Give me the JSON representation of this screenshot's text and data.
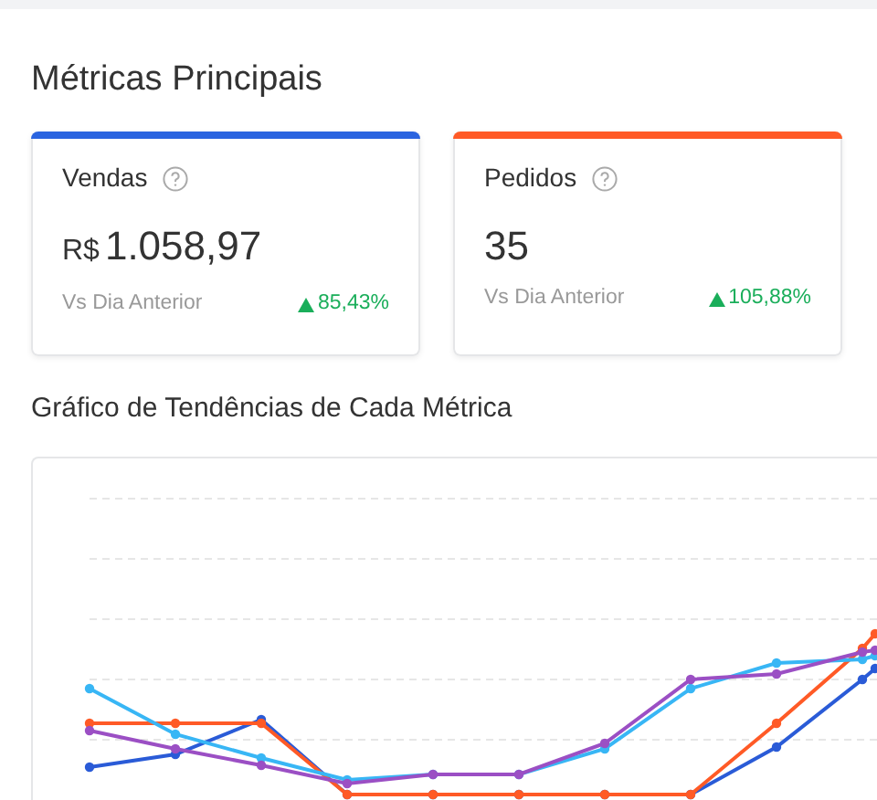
{
  "section_title": "Métricas Principais",
  "metrics": [
    {
      "label": "Vendas",
      "currency": "R$",
      "value": "1.058,97",
      "comparison_label": "Vs Dia Anterior",
      "change": "85,43%",
      "positive": true,
      "color": "#2a64e0"
    },
    {
      "label": "Pedidos",
      "value": "35",
      "comparison_label": "Vs Dia Anterior",
      "change": "105,88%",
      "positive": true,
      "color": "#ff5a26"
    }
  ],
  "chart_title": "Gráfico de Tendências de Cada Métrica"
}
